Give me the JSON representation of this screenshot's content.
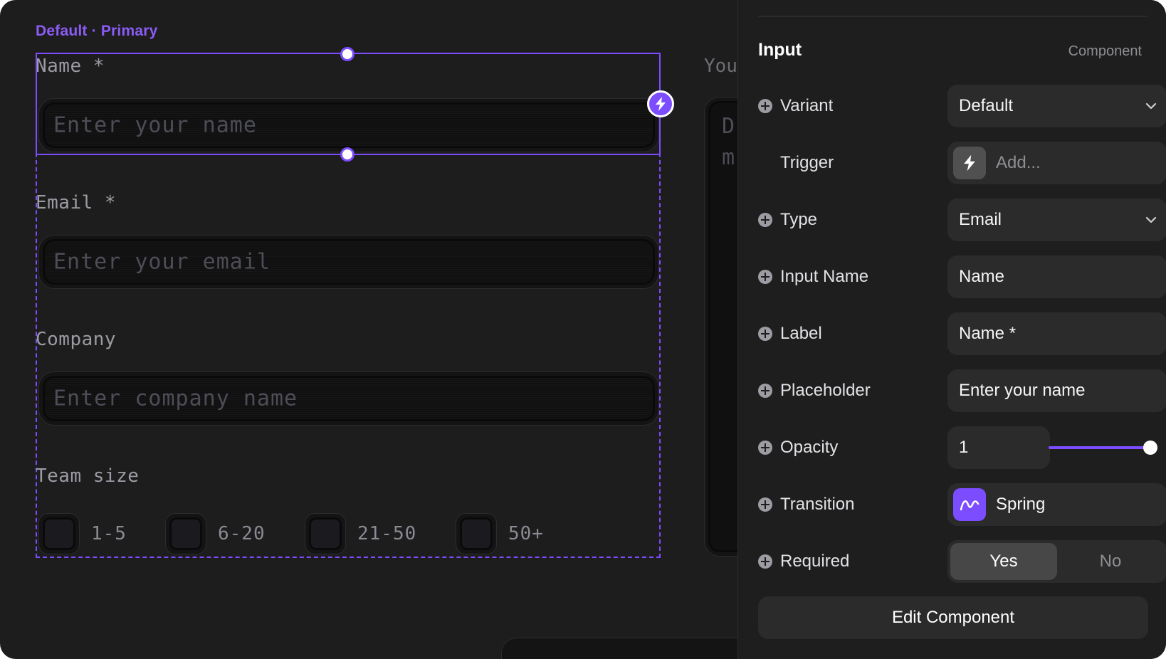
{
  "canvas": {
    "variant_label": "Default · Primary",
    "fields": [
      {
        "label": "Name *",
        "placeholder": "Enter your name"
      },
      {
        "label": "Email *",
        "placeholder": "Enter your email"
      },
      {
        "label": "Company",
        "placeholder": "Enter company name"
      }
    ],
    "team_size": {
      "label": "Team size",
      "options": [
        "1-5",
        "6-20",
        "21-50",
        "50+"
      ]
    },
    "peek": {
      "label": "You",
      "placeholder_line1": "D",
      "placeholder_line2": "m"
    }
  },
  "inspector": {
    "title": "Input",
    "subtitle": "Component",
    "accent_color": "#7c4dff",
    "props": {
      "variant": {
        "name": "Variant",
        "value": "Default"
      },
      "trigger": {
        "name": "Trigger",
        "value": "Add..."
      },
      "type": {
        "name": "Type",
        "value": "Email"
      },
      "input_name": {
        "name": "Input Name",
        "value": "Name"
      },
      "label": {
        "name": "Label",
        "value": "Name *"
      },
      "placeholder": {
        "name": "Placeholder",
        "value": "Enter your name"
      },
      "opacity": {
        "name": "Opacity",
        "value": "1",
        "slider_fraction": 1.0
      },
      "transition": {
        "name": "Transition",
        "value": "Spring"
      },
      "required": {
        "name": "Required",
        "yes": "Yes",
        "no": "No",
        "selected": "Yes"
      }
    },
    "edit_button": "Edit Component"
  }
}
